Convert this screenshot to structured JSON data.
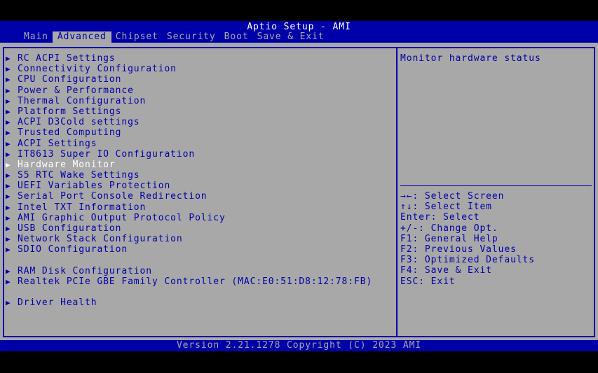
{
  "header": {
    "title": "Aptio Setup - AMI",
    "tabs": [
      {
        "label": "Main",
        "active": false
      },
      {
        "label": "Advanced",
        "active": true
      },
      {
        "label": "Chipset",
        "active": false
      },
      {
        "label": "Security",
        "active": false
      },
      {
        "label": "Boot",
        "active": false
      },
      {
        "label": "Save & Exit",
        "active": false
      }
    ]
  },
  "menu": {
    "arrow_icon": "▶",
    "items": [
      "RC ACPI Settings",
      "Connectivity Configuration",
      "CPU Configuration",
      "Power & Performance",
      "Thermal Configuration",
      "Platform Settings",
      "ACPI D3Cold settings",
      "Trusted Computing",
      "ACPI Settings",
      "IT8613 Super IO Configuration",
      "Hardware Monitor",
      "S5 RTC Wake Settings",
      "UEFI Variables Protection",
      "Serial Port Console Redirection",
      "Intel TXT Information",
      "AMI Graphic Output Protocol Policy",
      "USB Configuration",
      "Network Stack Configuration",
      "SDIO Configuration",
      "RAM Disk Configuration",
      "Realtek PCIe GBE Family Controller (MAC:E0:51:D8:12:78:FB)",
      "Driver Health"
    ],
    "selected": "Hardware Monitor"
  },
  "help": {
    "description": "Monitor hardware status",
    "keys": [
      "→←: Select Screen",
      "↑↓: Select Item",
      "Enter: Select",
      "+/-: Change Opt.",
      "F1: General Help",
      "F2: Previous Values",
      "F3: Optimized Defaults",
      "F4: Save & Exit",
      "ESC: Exit"
    ]
  },
  "footer": {
    "version": "Version 2.21.1278 Copyright (C) 2023 AMI"
  },
  "colors": {
    "bios_blue": "#0000a8",
    "bios_gray": "#a8a8a8",
    "highlight_white": "#ffffff",
    "background_black": "#000000"
  }
}
